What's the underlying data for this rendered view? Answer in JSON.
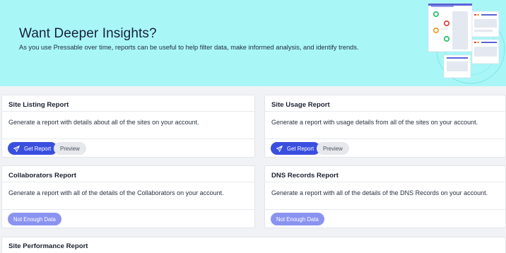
{
  "hero": {
    "title": "Want Deeper Insights?",
    "subtitle": "As you use Pressable over time, reports can be useful to help filter data, make informed analysis, and identify trends."
  },
  "colors": {
    "hero_bg": "#a9f6f7",
    "primary": "#3a4fe0",
    "disabled": "#8b93f0"
  },
  "reports": {
    "site_listing": {
      "title": "Site Listing Report",
      "description": "Generate a report with details about all of the sites on your account.",
      "get_label": "Get Report",
      "preview_label": "Preview"
    },
    "site_usage": {
      "title": "Site Usage Report",
      "description": "Generate a report with usage details from all of the sites on your account.",
      "get_label": "Get Report",
      "preview_label": "Preview"
    },
    "collaborators": {
      "title": "Collaborators Report",
      "description": "Generate a report with all of the details of the Collaborators on your account.",
      "disabled_label": "Not Enough Data"
    },
    "dns_records": {
      "title": "DNS Records Report",
      "description": "Generate a report with all of the details of the DNS Records on your account.",
      "disabled_label": "Not Enough Data"
    },
    "site_performance": {
      "title": "Site Performance Report"
    }
  },
  "icons": {
    "get_report": "send-icon",
    "illustration": "report-dashboard-illustration"
  }
}
